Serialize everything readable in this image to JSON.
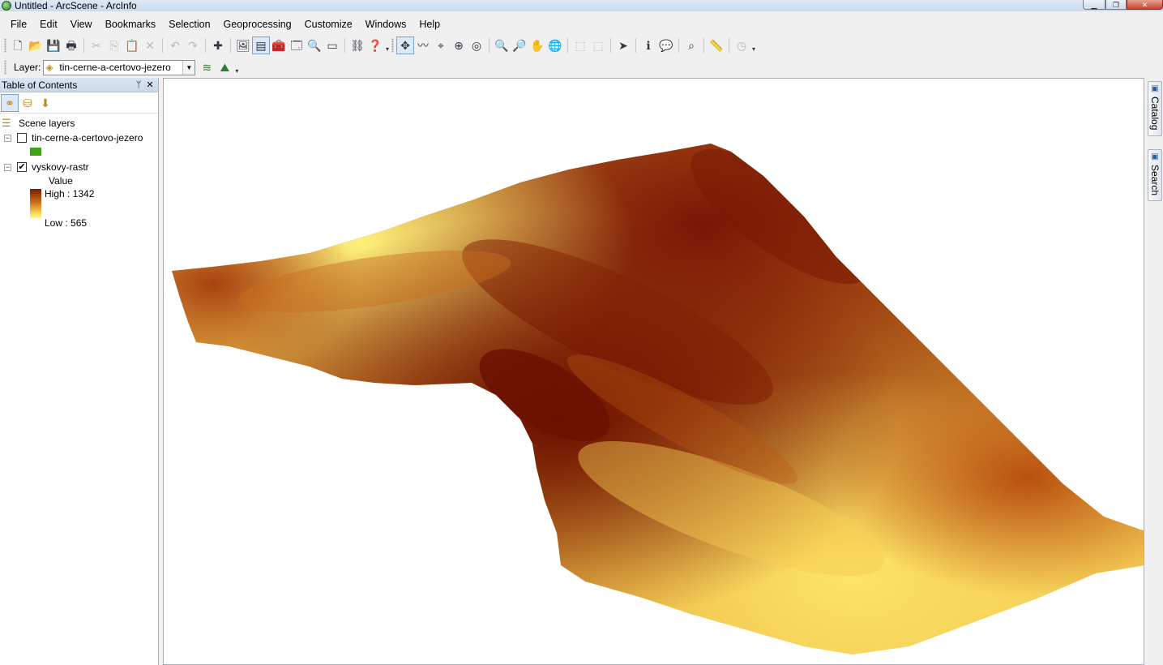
{
  "window": {
    "title": "Untitled - ArcScene - ArcInfo",
    "minimize_glyph": "▁",
    "maximize_glyph": "❐",
    "close_glyph": "✕"
  },
  "menu": [
    "File",
    "Edit",
    "View",
    "Bookmarks",
    "Selection",
    "Geoprocessing",
    "Customize",
    "Windows",
    "Help"
  ],
  "toolbar_main": [
    {
      "name": "new-document",
      "glyph": "🗋",
      "state": "normal"
    },
    {
      "name": "open-document",
      "glyph": "📂",
      "state": "normal"
    },
    {
      "name": "save",
      "glyph": "💾",
      "state": "normal"
    },
    {
      "name": "print",
      "glyph": "🖶",
      "state": "normal"
    },
    {
      "sep": true
    },
    {
      "name": "cut",
      "glyph": "✂",
      "state": "disabled"
    },
    {
      "name": "copy",
      "glyph": "⎘",
      "state": "disabled"
    },
    {
      "name": "paste",
      "glyph": "📋",
      "state": "disabled"
    },
    {
      "name": "delete",
      "glyph": "✕",
      "state": "disabled"
    },
    {
      "sep": true
    },
    {
      "name": "undo",
      "glyph": "↶",
      "state": "disabled"
    },
    {
      "name": "redo",
      "glyph": "↷",
      "state": "disabled"
    },
    {
      "sep": true
    },
    {
      "name": "add-data",
      "glyph": "✚",
      "state": "normal"
    },
    {
      "sep": true
    },
    {
      "name": "scene-properties",
      "glyph": "🖼",
      "state": "normal"
    },
    {
      "name": "table-of-contents",
      "glyph": "▤",
      "state": "active"
    },
    {
      "name": "arc-toolbox",
      "glyph": "🧰",
      "state": "normal"
    },
    {
      "name": "catalog-window",
      "glyph": "🗔",
      "state": "normal"
    },
    {
      "name": "search-window",
      "glyph": "🔍",
      "state": "normal"
    },
    {
      "name": "python-window",
      "glyph": "▭",
      "state": "normal"
    },
    {
      "sep": true
    },
    {
      "name": "model-builder",
      "glyph": "⛓",
      "state": "normal"
    },
    {
      "name": "whats-this-help",
      "glyph": "❓",
      "state": "normal"
    },
    {
      "overflow": true
    },
    {
      "grip": true
    },
    {
      "name": "navigate",
      "glyph": "✥",
      "state": "active"
    },
    {
      "name": "fly",
      "glyph": "〰",
      "state": "normal"
    },
    {
      "name": "target-center",
      "glyph": "⌖",
      "state": "normal"
    },
    {
      "name": "zoom-to-target",
      "glyph": "⊕",
      "state": "normal"
    },
    {
      "name": "set-observer",
      "glyph": "◎",
      "state": "normal"
    },
    {
      "sep": true
    },
    {
      "name": "zoom-in",
      "glyph": "🔍",
      "state": "normal"
    },
    {
      "name": "zoom-out",
      "glyph": "🔎",
      "state": "normal"
    },
    {
      "name": "pan",
      "glyph": "✋",
      "state": "normal"
    },
    {
      "name": "full-extent",
      "glyph": "🌐",
      "state": "normal"
    },
    {
      "sep": true
    },
    {
      "name": "select-features",
      "glyph": "⬚",
      "state": "disabled"
    },
    {
      "name": "clear-selection",
      "glyph": "⬚",
      "state": "disabled"
    },
    {
      "sep": true
    },
    {
      "name": "select-elements",
      "glyph": "➤",
      "state": "normal"
    },
    {
      "sep": true
    },
    {
      "name": "identify",
      "glyph": "ℹ",
      "state": "normal"
    },
    {
      "name": "html-popup",
      "glyph": "💬",
      "state": "disabled"
    },
    {
      "sep": true
    },
    {
      "name": "find",
      "glyph": "⌕",
      "state": "normal"
    },
    {
      "sep": true
    },
    {
      "name": "measure",
      "glyph": "📏",
      "state": "normal"
    },
    {
      "sep": true
    },
    {
      "name": "time-slider",
      "glyph": "◷",
      "state": "disabled"
    },
    {
      "overflow": true
    }
  ],
  "layer_toolbar": {
    "label": "Layer:",
    "selected": "tin-cerne-a-certovo-jezero",
    "tools": [
      {
        "name": "interpolate-line",
        "glyph": "≋"
      },
      {
        "name": "interpolate-point",
        "glyph": "⛰"
      }
    ]
  },
  "toc": {
    "title": "Table of Contents",
    "pin_glyph": "ᛘ",
    "close_glyph": "✕",
    "tools": [
      {
        "name": "list-by-drawing-order",
        "glyph": "⚭",
        "state": "active"
      },
      {
        "name": "list-by-source",
        "glyph": "⛁",
        "state": "normal"
      },
      {
        "name": "list-by-visibility",
        "glyph": "⬇",
        "state": "normal"
      }
    ],
    "root": "Scene layers",
    "layers": [
      {
        "name": "tin-cerne-a-certovo-jezero",
        "checked": false,
        "symbol_color": "#3da317"
      },
      {
        "name": "vyskovy-rastr",
        "checked": true,
        "field": "Value",
        "high": "High : 1342",
        "low": "Low : 565"
      }
    ]
  },
  "dock_tabs": [
    "Catalog",
    "Search"
  ],
  "colors": {
    "dem_high": "#6b0f00",
    "dem_mid": "#c97818",
    "dem_low": "#fdf07a"
  }
}
